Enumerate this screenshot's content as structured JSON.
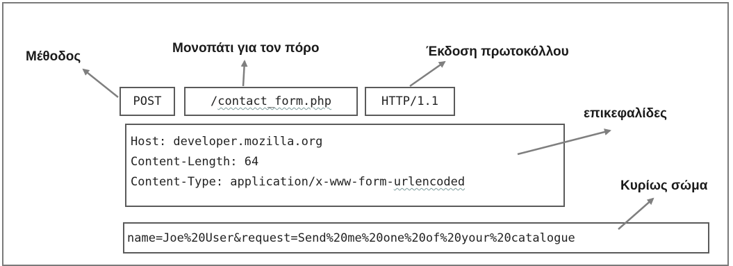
{
  "labels": {
    "method": "Μέθοδος",
    "path": "Μονοπάτι για τον πόρο",
    "version": "Έκδοση πρωτοκόλλου",
    "headers": "επικεφαλίδες",
    "body": "Κυρίως σώμα"
  },
  "request_line": {
    "method": "POST",
    "path_prefix": "/",
    "path_rest": "contact_form.php",
    "version": "HTTP/1.1"
  },
  "headers": {
    "line1": "Host: developer.mozilla.org",
    "line2": "Content-Length: 64",
    "line3_prefix": "Content-Type: application/x-www-form-",
    "line3_suffix": "urlencoded"
  },
  "body": {
    "text": "name=Joe%20User&request=Send%20me%20one%20of%20your%20catalogue"
  },
  "colors": {
    "arrow": "#7f7f7f",
    "box_border": "#5a5a5a",
    "frame_border": "#7a7a7a",
    "text": "#1a1a1a"
  }
}
